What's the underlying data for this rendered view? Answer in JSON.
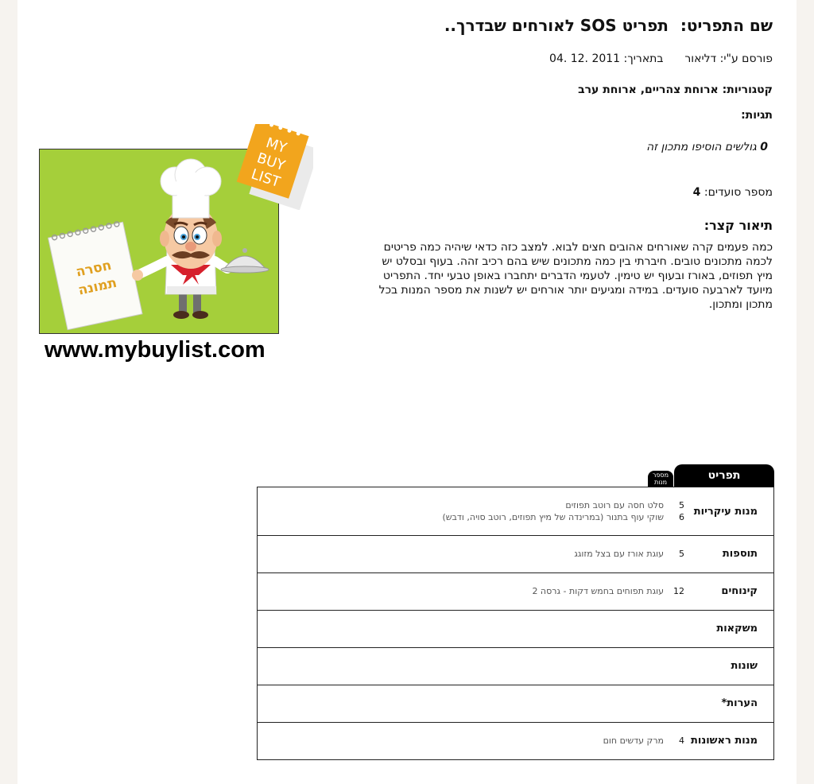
{
  "recipe": {
    "title_label": "שם התפריט:",
    "title": "תפריט SOS לאורחים שבדרך..",
    "posted_by_label": "פורסם ע\"י:",
    "author": "דליאור",
    "date_label": "בתאריך:",
    "date": "04. 12. 2011",
    "categories_label": "קטגוריות:",
    "categories": "ארוחת צהריים, ארוחת ערב",
    "tags_label": "תגיות:",
    "added_count": "0",
    "added_text": "גולשים הוסיפו מתכון זה",
    "servings_label": "מספר סועדים:",
    "servings": "4",
    "short_desc_label": "תיאור קצר:",
    "description": "כמה פעמים קרה שאורחים אהובים חצים לבוא. למצב כזה כדאי שיהיה כמה פריטים לכמה מתכונים טובים. חיברתי בין כמה מתכונים שיש בהם רכיב זהה. בעוף ובסלט יש מיץ תפוזים, באורז ובעוף יש טימין. לטעמי הדברים יתחברו באופן טבעי יחד. התפריט מיועד לארבעה סועדים. במידה ומגיעים יותר אורחים יש לשנות את מספר המנות בכל מתכון ומתכון."
  },
  "image": {
    "stamp_text": [
      "MY",
      "BUY",
      "LIST"
    ],
    "placeholder_text": [
      "חסרה",
      "תמונה"
    ],
    "site_url": "www.mybuylist.com",
    "colors": {
      "background": "#a5cf3a",
      "stamp": "#f2a51d",
      "placeholder_text": "#e0a020"
    }
  },
  "menu_table": {
    "tab_label": "תפריט",
    "count_tab_label": [
      "מספר",
      "מנות"
    ],
    "rows": [
      {
        "category": "מנות עיקריות",
        "items": [
          {
            "qty": "5",
            "name": "סלט חסה עם רוטב תפוזים"
          },
          {
            "qty": "6",
            "name": "שוקי עוף בתנור (במרינדה של מיץ תפוזים, רוטב סויה, ודבש)"
          }
        ]
      },
      {
        "category": "תוספות",
        "items": [
          {
            "qty": "5",
            "name": "עוגת אורז עם בצל מזוגג"
          }
        ]
      },
      {
        "category": "קינוחים",
        "items": [
          {
            "qty": "12",
            "name": "עוגת תפוחים בחמש דקות - גרסה 2"
          }
        ]
      },
      {
        "category": "משקאות",
        "items": []
      },
      {
        "category": "שונות",
        "items": []
      },
      {
        "category": "הערות*",
        "items": []
      },
      {
        "category": "מנות ראשונות",
        "items": [
          {
            "qty": "4",
            "name": "מרק עדשים חום"
          }
        ]
      }
    ]
  }
}
